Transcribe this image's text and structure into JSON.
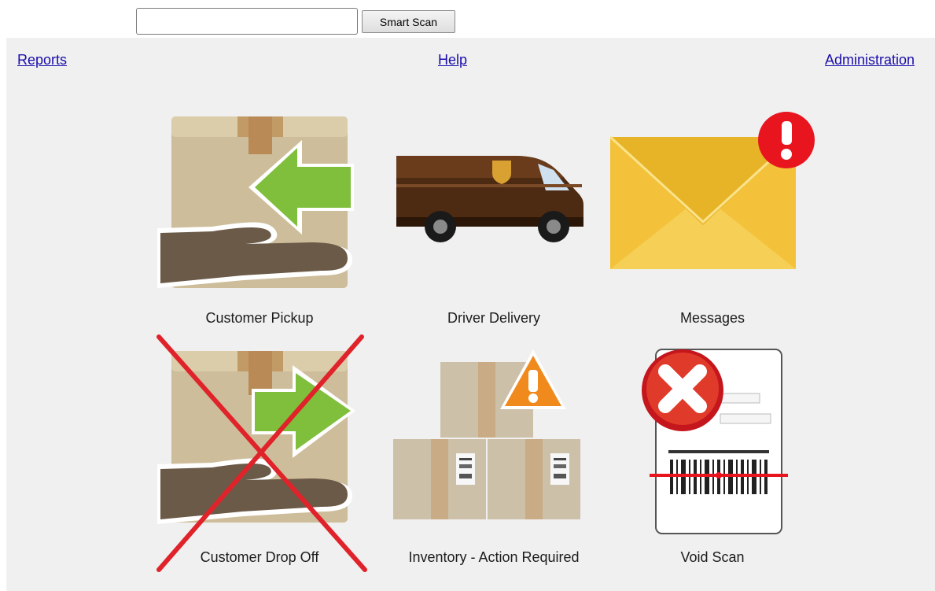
{
  "search": {
    "value": "",
    "placeholder": ""
  },
  "smart_scan_label": "Smart Scan",
  "nav": {
    "reports": "Reports",
    "help": "Help",
    "administration": "Administration"
  },
  "tiles": [
    {
      "label": "Customer Pickup",
      "icon": "customer-pickup-icon",
      "disabled": false
    },
    {
      "label": "Driver Delivery",
      "icon": "delivery-truck-icon",
      "disabled": false
    },
    {
      "label": "Messages",
      "icon": "envelope-alert-icon",
      "disabled": false
    },
    {
      "label": "Customer Drop Off",
      "icon": "customer-drop-off-icon",
      "disabled": true
    },
    {
      "label": "Inventory - Action Required",
      "icon": "inventory-warning-icon",
      "disabled": false
    },
    {
      "label": "Void Scan",
      "icon": "void-scan-icon",
      "disabled": false
    }
  ],
  "colors": {
    "link": "#1a0dab",
    "panel_bg": "#f0f0f0",
    "box": "#cdbd9a",
    "arrow_green": "#7fbf3c",
    "hand": "#6b5a48",
    "truck": "#4d2a12",
    "envelope": "#f3c23a",
    "alert_red": "#e8151f",
    "warning_orange": "#f08a1c",
    "cross_red": "#e0232b"
  }
}
